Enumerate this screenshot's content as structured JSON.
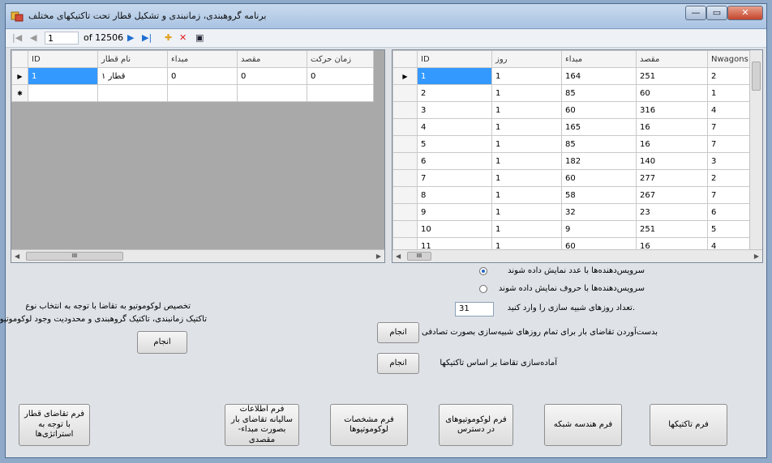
{
  "window": {
    "title": "برنامه گروهبندی، زمانبندی و تشکیل قطار تحت تاکتیکهای مختلف",
    "min_label": "—",
    "max_label": "▭",
    "close_label": "✕"
  },
  "navigator": {
    "first_label": "|◀",
    "prev_label": "◀",
    "position": "1",
    "count": "of 12506",
    "next_label": "▶",
    "last_label": "▶|",
    "add_label": "✚",
    "delete_label": "✕",
    "save_label": "▣"
  },
  "left_grid": {
    "columns": [
      "ID",
      "نام قطار",
      "مبداء",
      "مقصد",
      "زمان حرکت"
    ],
    "rows": [
      {
        "indicator": "▶",
        "cells": [
          "1",
          "قطار ۱",
          "0",
          "0",
          "0"
        ]
      },
      {
        "indicator": "✱",
        "cells": [
          "",
          "",
          "",
          "",
          ""
        ]
      }
    ],
    "scroll_label": "III"
  },
  "right_grid": {
    "columns": [
      "ID",
      "روز",
      "مبداء",
      "مقصد",
      "Nwagons"
    ],
    "rows": [
      {
        "indicator": "▶",
        "cells": [
          "1",
          "1",
          "164",
          "251",
          "2"
        ]
      },
      {
        "indicator": "",
        "cells": [
          "2",
          "1",
          "85",
          "60",
          "1"
        ]
      },
      {
        "indicator": "",
        "cells": [
          "3",
          "1",
          "60",
          "316",
          "4"
        ]
      },
      {
        "indicator": "",
        "cells": [
          "4",
          "1",
          "165",
          "16",
          "7"
        ]
      },
      {
        "indicator": "",
        "cells": [
          "5",
          "1",
          "85",
          "16",
          "7"
        ]
      },
      {
        "indicator": "",
        "cells": [
          "6",
          "1",
          "182",
          "140",
          "3"
        ]
      },
      {
        "indicator": "",
        "cells": [
          "7",
          "1",
          "60",
          "277",
          "2"
        ]
      },
      {
        "indicator": "",
        "cells": [
          "8",
          "1",
          "58",
          "267",
          "7"
        ]
      },
      {
        "indicator": "",
        "cells": [
          "9",
          "1",
          "32",
          "23",
          "6"
        ]
      },
      {
        "indicator": "",
        "cells": [
          "10",
          "1",
          "9",
          "251",
          "5"
        ]
      },
      {
        "indicator": "",
        "cells": [
          "11",
          "1",
          "60",
          "16",
          "4"
        ]
      }
    ],
    "scroll_label": "III"
  },
  "options": {
    "radio1_label": "سرویس‌دهنده‌ها با عدد نمایش داده شوند",
    "radio1_checked": true,
    "radio2_label": "سرویس‌دهنده‌ها با حروف نمایش داده شوند",
    "radio2_checked": false,
    "days_label": ".تعداد روزهای شبیه سازی را وارد کنید",
    "days_value": "31",
    "demand_label": "بدست‌آوردن تقاضای بار برای تمام روزهای شبیه‌سازی بصورت تصادفی",
    "demand_button": "انجام",
    "tactics_label": "آماده‌سازی تقاضا بر اساس تاکتیکها",
    "tactics_button": "انجام",
    "loco_line1": "تخصیص لوکوموتیو به تقاضا با توجه به انتخاب نوع",
    "loco_line2": "تاکتیک زمانبندی، تاکتیک گروهبندی و محدودیت وجود لوکوموتیو",
    "loco_button": "انجام"
  },
  "bottom_buttons": {
    "btn1": "فرم تقاضای قطار با توجه به استراتژی‌ها",
    "btn2": "فرم اطلاعات سالیانه تقاضای بار بصورت مبداء-مقصدی",
    "btn3": "فرم مشخصات لوکوموتیوها",
    "btn4": "فرم لوکوموتیوهای در دسترس",
    "btn5": "فرم هندسه شبکه",
    "btn6": "فرم تاکتیکها"
  },
  "colors": {
    "selection": "#3399ff",
    "grid_background": "#a9a9a9"
  }
}
